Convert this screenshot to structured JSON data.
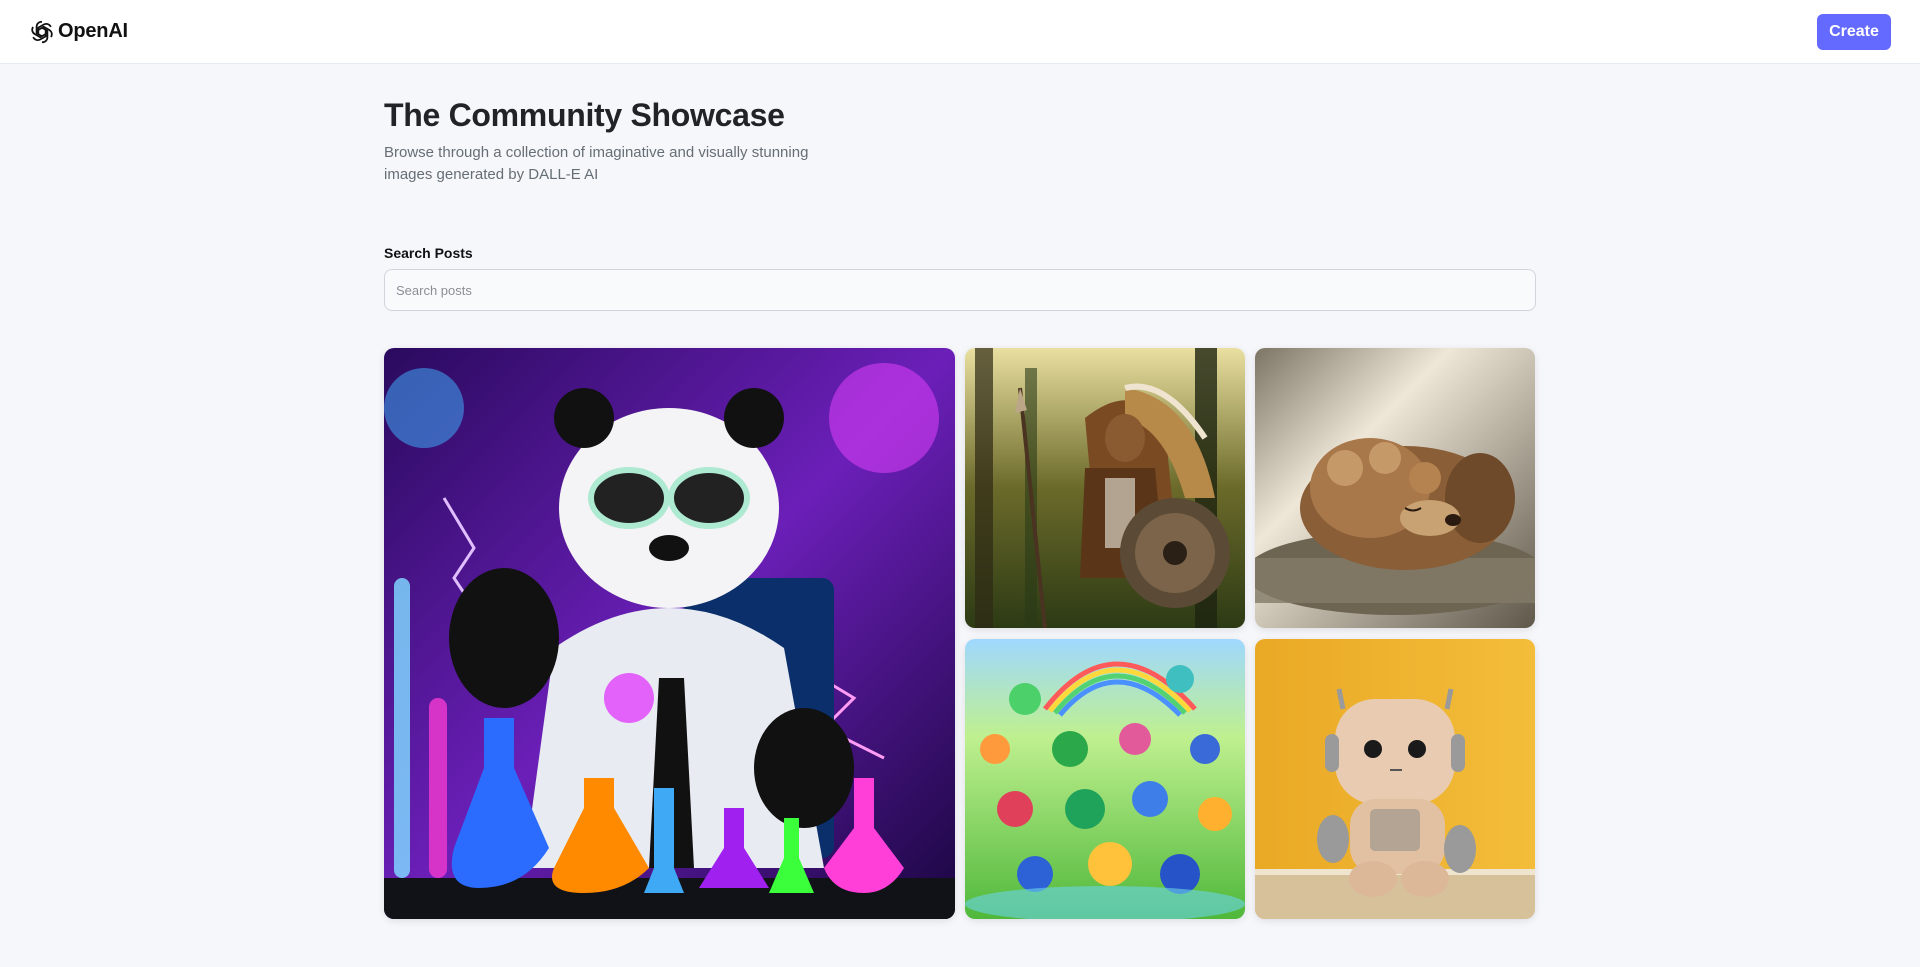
{
  "header": {
    "logo_text": "OpenAI",
    "logo_icon": "openai-logo-icon",
    "create_label": "Create",
    "accent_color": "#6469ff"
  },
  "hero": {
    "title": "The Community Showcase",
    "subtitle": "Browse through a collection of imaginative and visually stunning images generated by DALL-E AI"
  },
  "search": {
    "label": "Search Posts",
    "placeholder": "Search posts",
    "value": ""
  },
  "gallery": {
    "items": [
      {
        "subject": "panda scientist in lab with colorful flasks",
        "layout": "large"
      },
      {
        "subject": "native warrior with headdress, spear and shield in forest",
        "layout": "small"
      },
      {
        "subject": "curly puppy sleeping on a cushion",
        "layout": "small"
      },
      {
        "subject": "crowd of colorful baby dragons in a meadow with rainbow",
        "layout": "small"
      },
      {
        "subject": "plush robot toy against yellow wall",
        "layout": "small"
      }
    ]
  }
}
